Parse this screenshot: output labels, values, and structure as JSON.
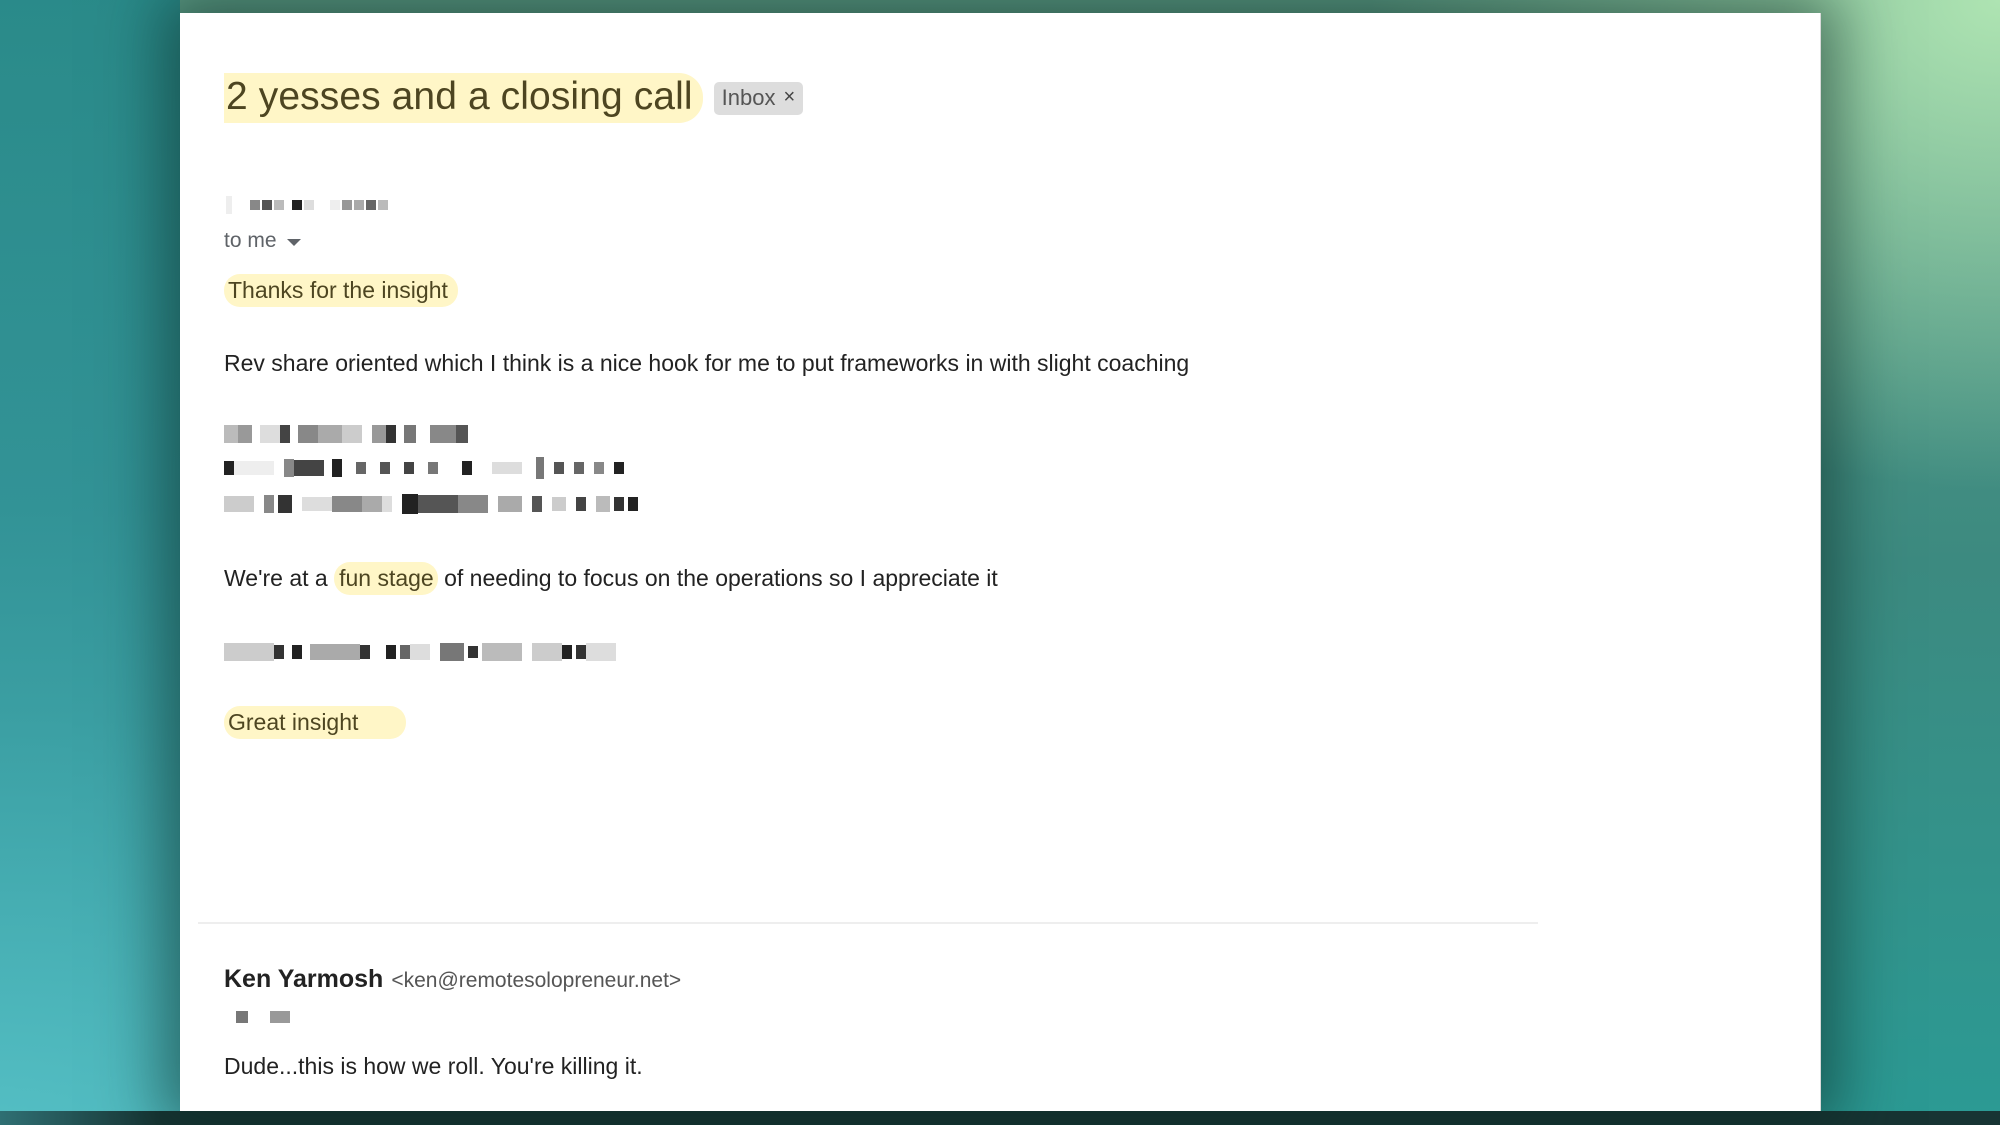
{
  "email": {
    "subject": "2 yesses and a closing call",
    "label": {
      "name": "Inbox",
      "close_symbol": "×"
    },
    "recipient": {
      "text": "to me",
      "icon": "caret-down-icon"
    },
    "highlight_color": "#fff6c7",
    "body": {
      "greeting": "Thanks for the insight",
      "paragraph1": "Rev share oriented which I think is a nice hook for me to put frameworks in with slight coaching",
      "paragraph2": {
        "before": "We're at a ",
        "highlight": "fun stage",
        "after": " of needing to focus on the operations so I appreciate it"
      },
      "closing": "Great insight"
    }
  },
  "reply": {
    "sender_name": "Ken Yarmosh",
    "sender_email": "<ken@remotesolopreneur.net>",
    "body": "Dude...this is how we roll. You're killing it."
  }
}
